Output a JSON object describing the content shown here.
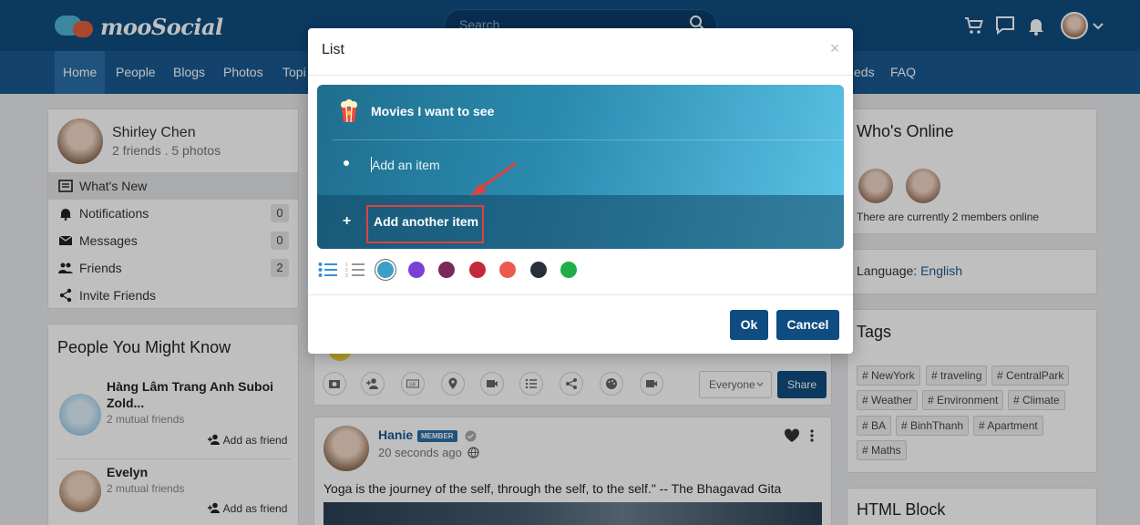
{
  "header": {
    "brand": "mooSocial",
    "search_placeholder": "Search",
    "icons": [
      "cart-icon",
      "chat-icon",
      "bell-icon",
      "user-avatar",
      "chevron-down-icon"
    ]
  },
  "nav": {
    "items": [
      "Home",
      "People",
      "Blogs",
      "Photos",
      "Topi",
      "eds",
      "FAQ"
    ],
    "active": "Home"
  },
  "profile": {
    "name": "Shirley Chen",
    "meta": "2 friends . 5 photos",
    "menu": [
      {
        "label": "What's New",
        "icon": "newspaper-icon",
        "count": ""
      },
      {
        "label": "Notifications",
        "icon": "bell-icon",
        "count": "0"
      },
      {
        "label": "Messages",
        "icon": "envelope-icon",
        "count": "0"
      },
      {
        "label": "Friends",
        "icon": "people-icon",
        "count": "2"
      },
      {
        "label": "Invite Friends",
        "icon": "share-icon",
        "count": ""
      }
    ]
  },
  "people_you_might_know": {
    "title": "People You Might Know",
    "people": [
      {
        "name": "Hàng Lâm Trang Anh Suboi Zold...",
        "mutual": "2 mutual friends",
        "action": "Add as friend"
      },
      {
        "name": "Evelyn",
        "mutual": "2 mutual friends",
        "action": "Add as friend"
      }
    ]
  },
  "whos_online": {
    "title": "Who's Online",
    "text": "There are currently 2 members online"
  },
  "language": {
    "label": "Language:",
    "value": "English"
  },
  "tags": {
    "title": "Tags",
    "items": [
      "# NewYork",
      "# traveling",
      "# CentralPark",
      "# Weather",
      "# Environment",
      "# Climate",
      "# BA",
      "# BinhThanh",
      "# Apartment",
      "# Maths"
    ]
  },
  "html_block": {
    "title": "HTML Block"
  },
  "composer": {
    "privacy": "Everyone",
    "share": "Share"
  },
  "post": {
    "author": "Hanie",
    "badge": "MEMBER",
    "time": "20 seconds ago",
    "text": "Yoga is the journey of the self, through the self, to the self.\" -- The Bhagavad Gita"
  },
  "modal": {
    "title": "List",
    "close": "×",
    "list_title": "Movies I want to see",
    "item_placeholder": "Add an item",
    "add_another": "Add another item",
    "colors": [
      "#3aa0c8",
      "#7b3fd6",
      "#7a2a5a",
      "#c22a3a",
      "#ea5a4e",
      "#2a2f3e",
      "#1fae48"
    ],
    "selected_color_index": 0,
    "ok": "Ok",
    "cancel": "Cancel"
  }
}
